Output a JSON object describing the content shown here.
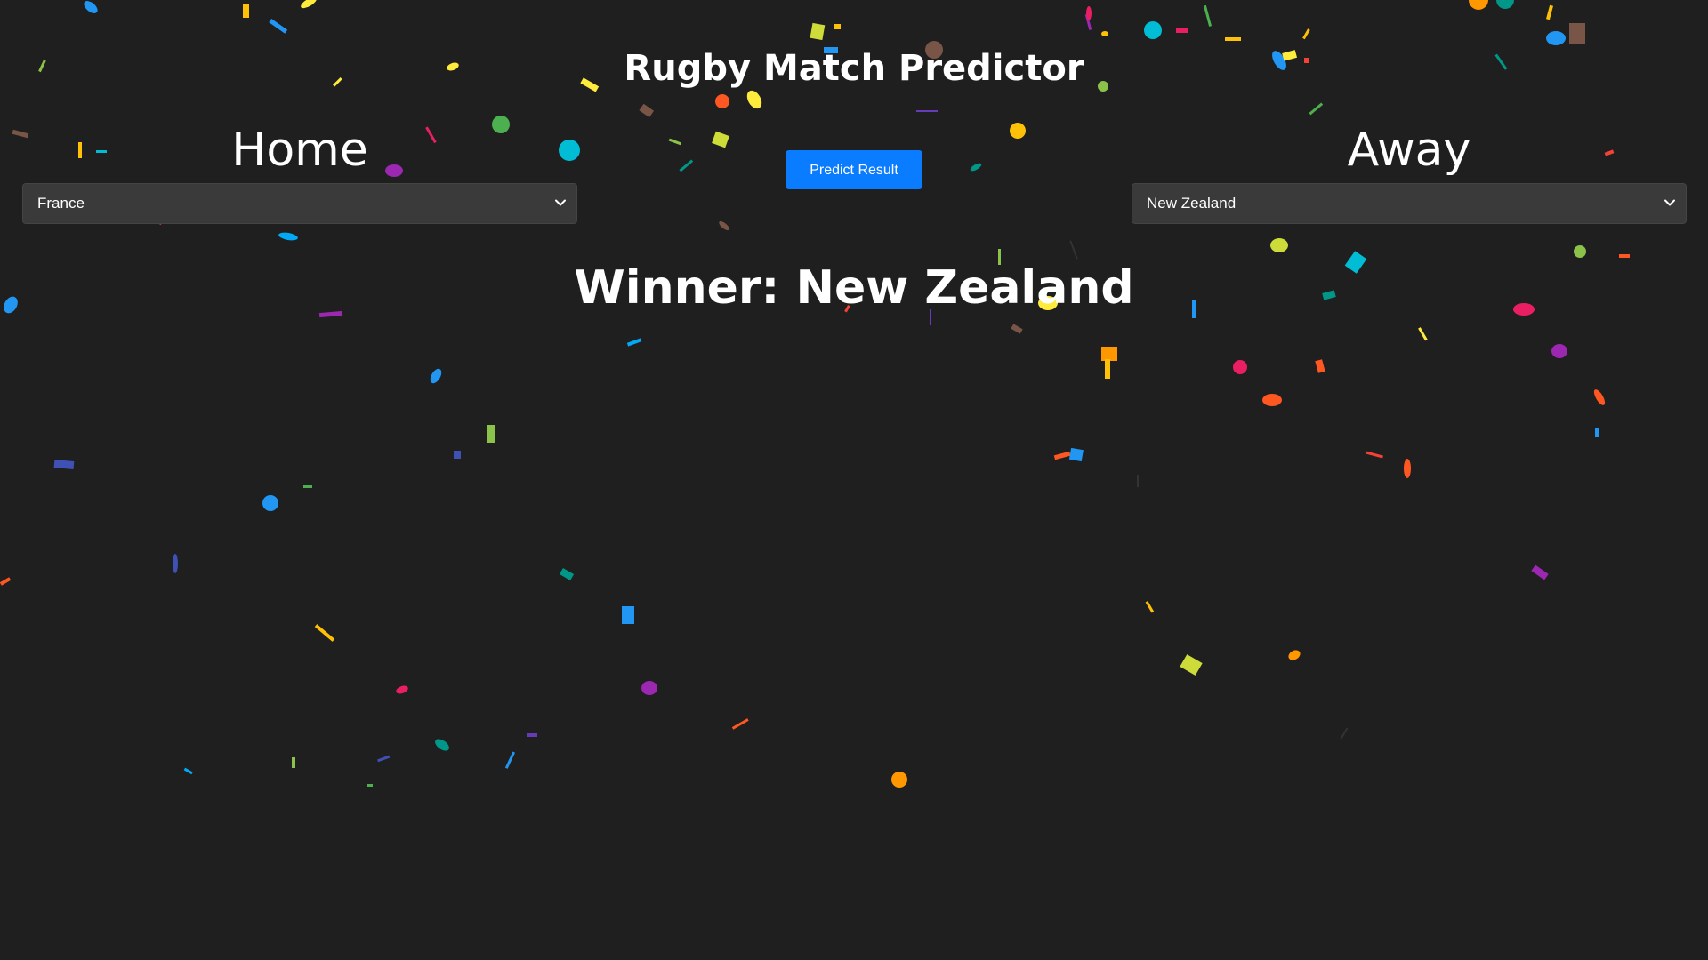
{
  "app": {
    "title": "Rugby Match Predictor"
  },
  "home": {
    "heading": "Home",
    "selected_team": "France"
  },
  "away": {
    "heading": "Away",
    "selected_team": "New Zealand"
  },
  "predict_button": {
    "label": "Predict Result"
  },
  "result": {
    "text": "Winner: New Zealand"
  },
  "colors": {
    "background": "#1f1f1f",
    "accent": "#0a7cff",
    "select_background": "#3a3a3a",
    "text": "#ffffff"
  },
  "icons": {
    "select_arrow": "chevron-down-icon"
  },
  "decoration": {
    "confetti_palette": [
      "#f44336",
      "#e91e63",
      "#9c27b0",
      "#673ab7",
      "#3f51b5",
      "#2196f3",
      "#03a9f4",
      "#00bcd4",
      "#009688",
      "#4caf50",
      "#8bc34a",
      "#cddc39",
      "#ffeb3b",
      "#ffc107",
      "#ff9800",
      "#ff5722",
      "#795548"
    ]
  }
}
